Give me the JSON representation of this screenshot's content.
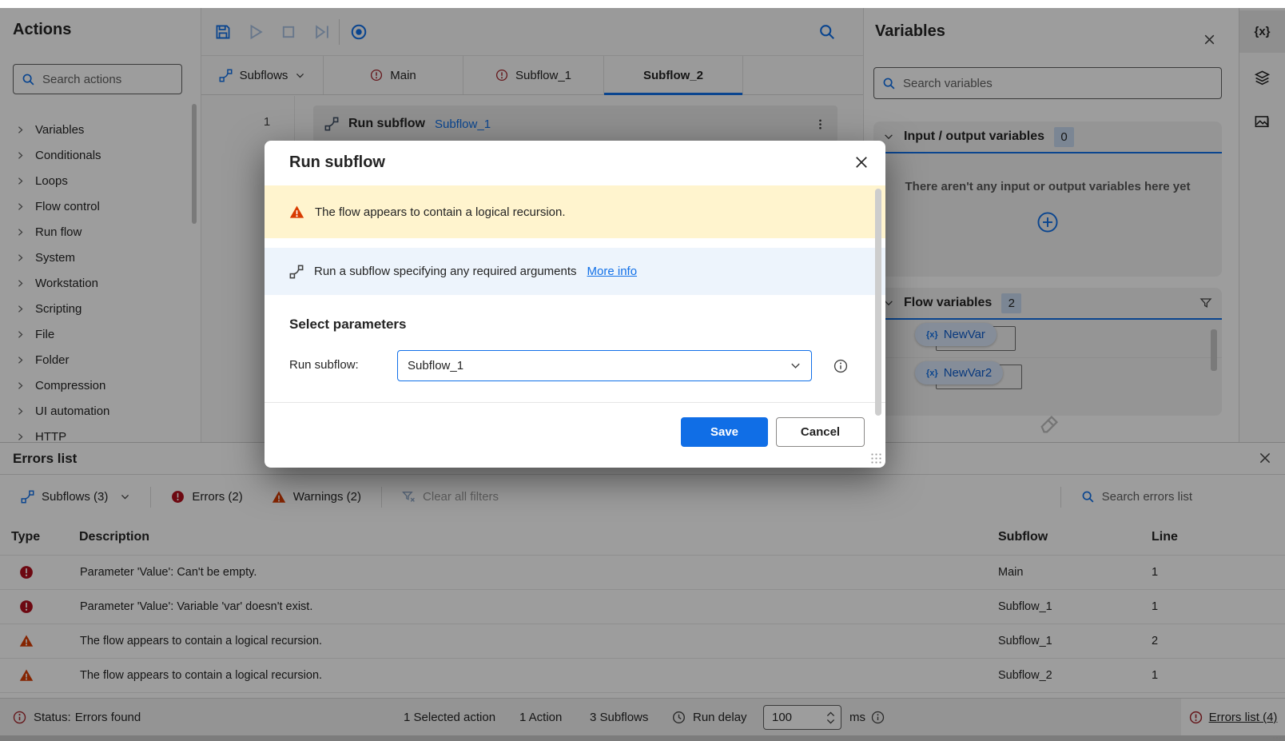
{
  "colors": {
    "accent": "#1170e8",
    "error": "#b10e1c",
    "error_dark": "#a4262c",
    "warning": "#d83b01",
    "banner_bg": "#fff4ce",
    "info_bg": "#edf4fc"
  },
  "actions_panel": {
    "title": "Actions",
    "search_placeholder": "Search actions",
    "categories": [
      "Variables",
      "Conditionals",
      "Loops",
      "Flow control",
      "Run flow",
      "System",
      "Workstation",
      "Scripting",
      "File",
      "Folder",
      "Compression",
      "UI automation",
      "HTTP"
    ]
  },
  "tab_bar": {
    "subflows_label": "Subflows",
    "tabs": [
      {
        "label": "Main",
        "has_error": true
      },
      {
        "label": "Subflow_1",
        "has_error": true
      },
      {
        "label": "Subflow_2",
        "has_error": false,
        "active": true
      }
    ]
  },
  "canvas": {
    "row_number": "1",
    "action_name": "Run subflow",
    "action_argument": "Subflow_1"
  },
  "dialog": {
    "title": "Run subflow",
    "warning_text": "The flow appears to contain a logical recursion.",
    "description": "Run a subflow specifying any required arguments",
    "more_info_label": "More info",
    "section_title": "Select parameters",
    "field_label": "Run subflow:",
    "field_value": "Subflow_1",
    "save_label": "Save",
    "cancel_label": "Cancel"
  },
  "variables_panel": {
    "title": "Variables",
    "search_placeholder": "Search variables",
    "io_title": "Input / output variables",
    "io_count": "0",
    "io_empty": "There aren't any input or output variables here yet",
    "flow_title": "Flow variables",
    "flow_count": "2",
    "variables": [
      {
        "prefix": "{x}",
        "name": "NewVar"
      },
      {
        "prefix": "{x}",
        "name": "NewVar2"
      }
    ]
  },
  "right_rail": {
    "variables_tab_label": "{x}"
  },
  "errors_panel": {
    "title": "Errors list",
    "subflows_filter": "Subflows (3)",
    "errors_filter": "Errors (2)",
    "warnings_filter": "Warnings (2)",
    "clear_filters": "Clear all filters",
    "search_placeholder": "Search errors list",
    "col_type": "Type",
    "col_description": "Description",
    "col_subflow": "Subflow",
    "col_line": "Line",
    "rows": [
      {
        "type": "error",
        "description": "Parameter 'Value': Can't be empty.",
        "subflow": "Main",
        "line": "1"
      },
      {
        "type": "error",
        "description": "Parameter 'Value': Variable 'var' doesn't exist.",
        "subflow": "Subflow_1",
        "line": "1"
      },
      {
        "type": "warning",
        "description": "The flow appears to contain a logical recursion.",
        "subflow": "Subflow_1",
        "line": "2"
      },
      {
        "type": "warning",
        "description": "The flow appears to contain a logical recursion.",
        "subflow": "Subflow_2",
        "line": "1"
      }
    ]
  },
  "status_bar": {
    "status_label": "Status:",
    "status_value": "Errors found",
    "selected_actions": "1 Selected action",
    "actions_count": "1 Action",
    "subflows_count": "3 Subflows",
    "run_delay_label": "Run delay",
    "run_delay_value": "100",
    "run_delay_unit": "ms",
    "errors_toggle_label": "Errors list (4)"
  }
}
